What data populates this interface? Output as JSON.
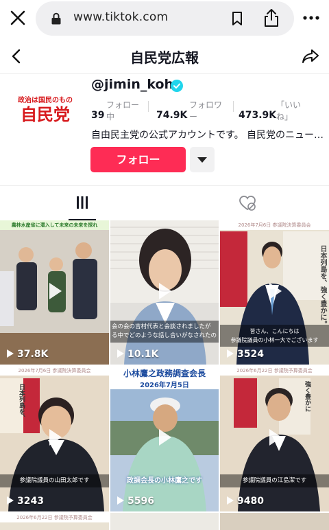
{
  "browser": {
    "url": "www.tiktok.com"
  },
  "header": {
    "title": "自民党広報"
  },
  "profile": {
    "avatar_tagline": "政治は国民のもの",
    "avatar_logo": "自民党",
    "username": "@jimin_koho",
    "stats": [
      {
        "value": "39",
        "label_line1": "フォロー",
        "label_line2": "中"
      },
      {
        "value": "74.9K",
        "label_line1": "フォロワ",
        "label_line2": "ー"
      },
      {
        "value": "473.9K",
        "label_line1": "「いい",
        "label_line2": "ね」"
      }
    ],
    "bio": "自由民主党の公式アカウントです。 自民党のニュー…",
    "follow_label": "フォロー"
  },
  "videos": [
    {
      "views": "37.8K",
      "top_banner": "農林水産省に潜入して未来の未来を探れ",
      "caption": ""
    },
    {
      "views": "10.1K",
      "top_banner": "",
      "caption": "会の会の吉村代表と会談されましたが\nる中でどのような話し合いがなされたの"
    },
    {
      "views": "3524",
      "top_banner": "2026年7月6日 参議院決算委員会",
      "caption": "皆さん、こんにちは\n参議院議員の小林一大でございます",
      "poster": "日本列島を、強く豊かに。"
    },
    {
      "views": "3243",
      "top_banner": "2026年7月6日 参議院決算委員会",
      "caption": "参議院議員の山田太郎です",
      "poster": "日本列島を、"
    },
    {
      "views": "5596",
      "top_banner": "小林鷹之政務調査会長",
      "date": "2026年7月5日",
      "caption": "政調会長の小林鷹之です"
    },
    {
      "views": "9480",
      "top_banner": "2026年6月22日 参議院予算委員会",
      "caption": "参議院議員の江島潔です",
      "poster": "強く豊かに"
    },
    {
      "views": "",
      "top_banner": "2026年6月22日 参議院予算委員会",
      "caption": ""
    }
  ],
  "colors": {
    "follow_red": "#fe2c55",
    "verified_blue": "#20d5ec",
    "logo_red": "#d7191c"
  }
}
